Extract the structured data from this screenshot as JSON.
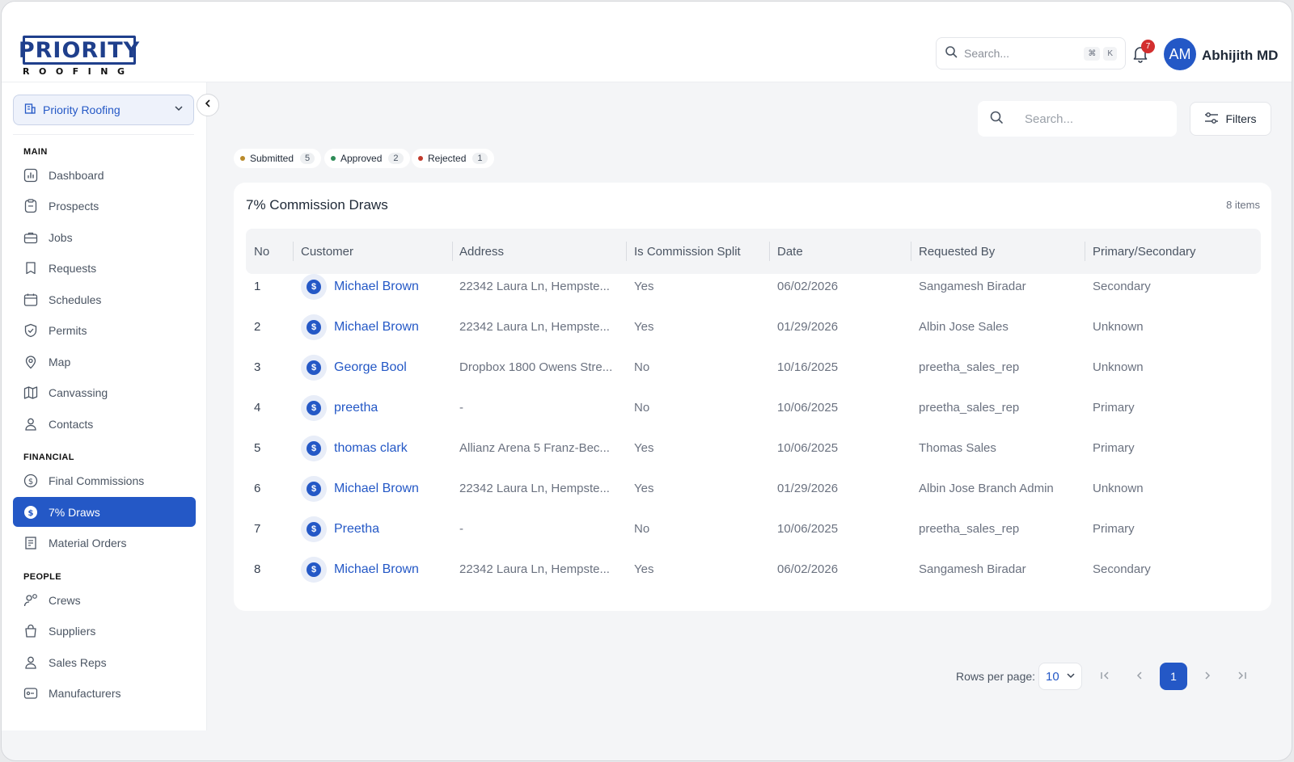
{
  "brand": {
    "logo_text": "PRIORITY",
    "logo_sub": "ROOFING",
    "accent": "#2458c6"
  },
  "header": {
    "search_placeholder": "Search...",
    "shortcut_cmd": "⌘",
    "shortcut_key": "K",
    "notification_count": "7",
    "avatar_initials": "AM",
    "user_name": "Abhijith MD"
  },
  "sidebar": {
    "org_name": "Priority Roofing",
    "sections": {
      "main": "MAIN",
      "financial": "FINANCIAL",
      "people": "PEOPLE"
    },
    "main_items": [
      "Dashboard",
      "Prospects",
      "Jobs",
      "Requests",
      "Schedules",
      "Permits",
      "Map",
      "Canvassing",
      "Contacts"
    ],
    "financial_items": [
      "Final Commissions",
      "7% Draws",
      "Material Orders"
    ],
    "people_items": [
      "Crews",
      "Suppliers",
      "Sales Reps",
      "Manufacturers"
    ],
    "active_item": "7% Draws"
  },
  "toolbar": {
    "search_placeholder": "Search...",
    "filters_label": "Filters"
  },
  "status_chips": [
    {
      "label": "Submitted",
      "count": "5",
      "color": "#b98a2b"
    },
    {
      "label": "Approved",
      "count": "2",
      "color": "#2e8b57"
    },
    {
      "label": "Rejected",
      "count": "1",
      "color": "#c0392b"
    }
  ],
  "table": {
    "title": "7% Commission Draws",
    "count_label": "8 items",
    "columns": [
      "No",
      "Customer",
      "Address",
      "Is Commission Split",
      "Date",
      "Requested By",
      "Primary/Secondary"
    ],
    "rows": [
      [
        "1",
        "Michael Brown",
        "22342 Laura Ln, Hempste...",
        "Yes",
        "06/02/2026",
        "Sangamesh Biradar",
        "Secondary"
      ],
      [
        "2",
        "Michael Brown",
        "22342 Laura Ln, Hempste...",
        "Yes",
        "01/29/2026",
        "Albin Jose Sales",
        "Unknown"
      ],
      [
        "3",
        "George Bool",
        "Dropbox 1800 Owens Stre...",
        "No",
        "10/16/2025",
        "preetha_sales_rep",
        "Unknown"
      ],
      [
        "4",
        "preetha",
        "-",
        "No",
        "10/06/2025",
        "preetha_sales_rep",
        "Primary"
      ],
      [
        "5",
        "thomas clark",
        "Allianz Arena 5 Franz-Bec...",
        "Yes",
        "10/06/2025",
        "Thomas Sales",
        "Primary"
      ],
      [
        "6",
        "Michael Brown",
        "22342 Laura Ln, Hempste...",
        "Yes",
        "01/29/2026",
        "Albin Jose Branch Admin",
        "Unknown"
      ],
      [
        "7",
        "Preetha",
        "-",
        "No",
        "10/06/2025",
        "preetha_sales_rep",
        "Primary"
      ],
      [
        "8",
        "Michael Brown",
        "22342 Laura Ln, Hempste...",
        "Yes",
        "06/02/2026",
        "Sangamesh Biradar",
        "Secondary"
      ]
    ]
  },
  "pagination": {
    "rows_per_page_label": "Rows per page:",
    "rows_per_page_value": "10",
    "current_page": "1"
  }
}
